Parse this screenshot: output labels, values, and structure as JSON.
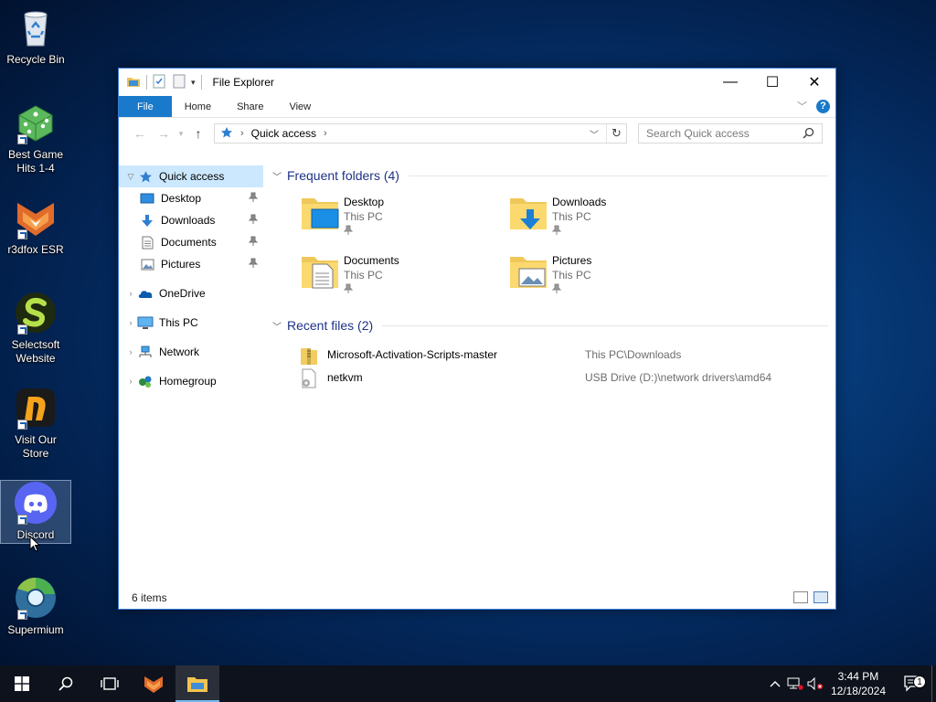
{
  "desktop": {
    "icons": [
      {
        "label": "Recycle Bin",
        "icon": "recycle-bin-icon",
        "shortcut": false
      },
      {
        "label": "Best Game Hits 1-4",
        "icon": "dice-icon",
        "shortcut": true
      },
      {
        "label": "r3dfox ESR",
        "icon": "r3dfox-icon",
        "shortcut": true
      },
      {
        "label": "Selectsoft Website",
        "icon": "selectsoft-icon",
        "shortcut": true
      },
      {
        "label": "Visit Our Store",
        "icon": "store-icon",
        "shortcut": true
      },
      {
        "label": "Discord",
        "icon": "discord-icon",
        "shortcut": true,
        "selected": true
      },
      {
        "label": "Supermium",
        "icon": "supermium-icon",
        "shortcut": true
      }
    ]
  },
  "window": {
    "title": "File Explorer",
    "controls": {
      "minimize": "—",
      "maximize": "☐",
      "close": "✕"
    },
    "ribbon_tabs": [
      "File",
      "Home",
      "Share",
      "View"
    ],
    "address": {
      "location": "Quick access",
      "search_placeholder": "Search Quick access"
    },
    "nav_pane": [
      {
        "label": "Quick access",
        "icon": "star-icon",
        "expanded": true,
        "selected": true,
        "level": 0
      },
      {
        "label": "Desktop",
        "icon": "desktop-folder-icon",
        "pinned": true,
        "level": 1
      },
      {
        "label": "Downloads",
        "icon": "download-arrow-icon",
        "pinned": true,
        "level": 1
      },
      {
        "label": "Documents",
        "icon": "document-icon",
        "pinned": true,
        "level": 1
      },
      {
        "label": "Pictures",
        "icon": "picture-icon",
        "pinned": true,
        "level": 1
      },
      {
        "label": "OneDrive",
        "icon": "onedrive-cloud-icon",
        "level": 0
      },
      {
        "label": "This PC",
        "icon": "computer-icon",
        "level": 0
      },
      {
        "label": "Network",
        "icon": "network-icon",
        "level": 0
      },
      {
        "label": "Homegroup",
        "icon": "homegroup-icon",
        "level": 0
      }
    ],
    "frequent": {
      "header": "Frequent folders (4)",
      "folders": [
        {
          "name": "Desktop",
          "location": "This PC",
          "overlay": "desktop"
        },
        {
          "name": "Downloads",
          "location": "This PC",
          "overlay": "download"
        },
        {
          "name": "Documents",
          "location": "This PC",
          "overlay": "document"
        },
        {
          "name": "Pictures",
          "location": "This PC",
          "overlay": "picture"
        }
      ]
    },
    "recent": {
      "header": "Recent files (2)",
      "files": [
        {
          "name": "Microsoft-Activation-Scripts-master",
          "path": "This PC\\Downloads",
          "icon": "zip-folder-icon"
        },
        {
          "name": "netkvm",
          "path": "USB Drive (D:)\\network drivers\\amd64",
          "icon": "settings-file-icon"
        }
      ]
    },
    "status": "6 items"
  },
  "taskbar": {
    "time": "3:44 PM",
    "date": "12/18/2024",
    "notification_count": "1",
    "accent": "#76b9ed"
  }
}
